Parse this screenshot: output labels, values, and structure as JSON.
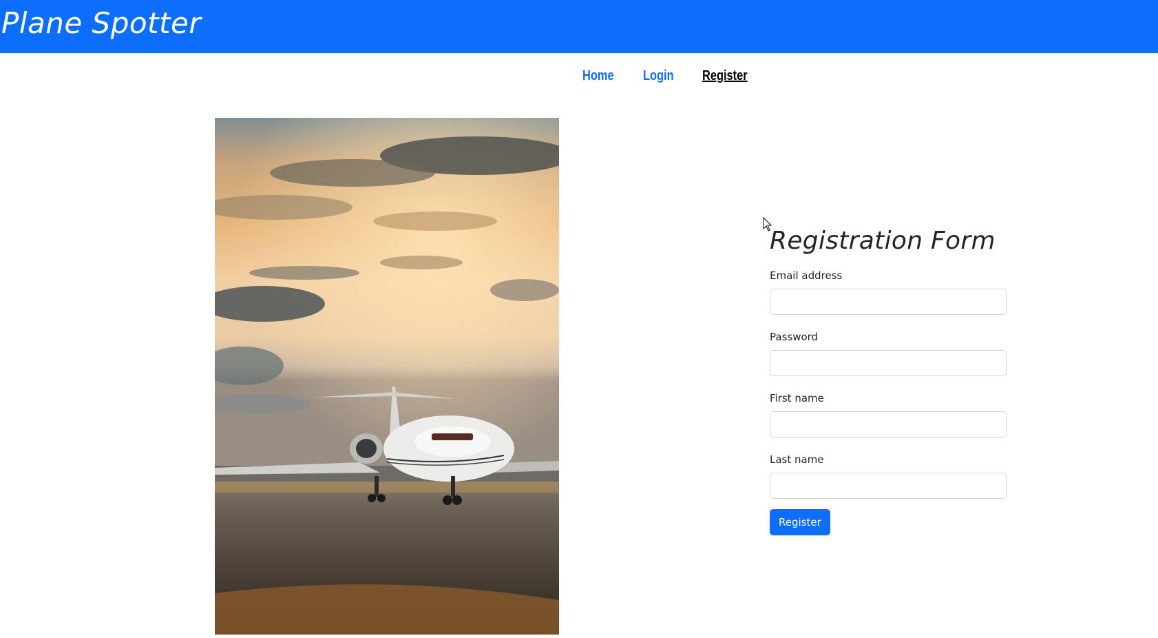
{
  "header": {
    "brand": "Plane Spotter",
    "background_color": "#0d6efd"
  },
  "nav": {
    "items": [
      {
        "label": "Home",
        "active": false
      },
      {
        "label": "Login",
        "active": false
      },
      {
        "label": "Register",
        "active": true
      }
    ]
  },
  "hero_image": {
    "description_icon": "airplane-photo"
  },
  "form": {
    "title": "Registration Form",
    "fields": [
      {
        "label": "Email address",
        "value": "",
        "type": "email"
      },
      {
        "label": "Password",
        "value": "",
        "type": "password"
      },
      {
        "label": "First name",
        "value": "",
        "type": "text"
      },
      {
        "label": "Last name",
        "value": "",
        "type": "text"
      }
    ],
    "submit_label": "Register",
    "accent_color": "#0d6efd"
  }
}
